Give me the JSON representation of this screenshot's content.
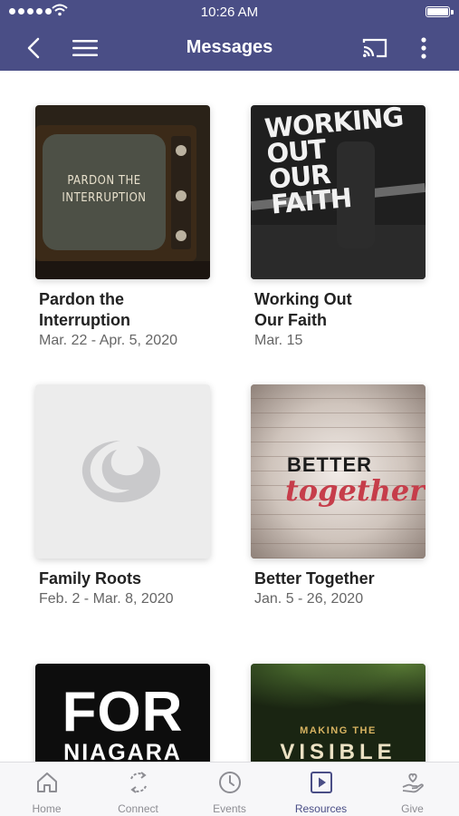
{
  "status_bar": {
    "time": "10:26 AM"
  },
  "header": {
    "title": "Messages"
  },
  "colors": {
    "accent": "#4a4e86",
    "tab_inactive": "#8d8d93"
  },
  "messages": [
    {
      "title": "Pardon the\nInterruption",
      "date": "Mar. 22 - Apr. 5, 2020",
      "art_text": "PARDON THE\nINTERRUPTION"
    },
    {
      "title": "Working Out\nOur Faith",
      "date": "Mar. 15",
      "art_text": "WORKING OUT\nOUR\nFAITH"
    },
    {
      "title": "Family Roots",
      "date": "Feb. 2 - Mar. 8, 2020"
    },
    {
      "title": "Better Together",
      "date": "Jan. 5 - 26, 2020",
      "art_text_1": "BETTER",
      "art_text_2": "together"
    },
    {
      "title": "",
      "date": "",
      "art_text_1": "FOR",
      "art_text_2": "NIAGARA"
    },
    {
      "title": "",
      "date": "",
      "art_text_1": "MAKING THE",
      "art_text_2": "VISIBLE"
    }
  ],
  "tabs": [
    {
      "label": "Home",
      "icon": "home-icon"
    },
    {
      "label": "Connect",
      "icon": "connect-icon"
    },
    {
      "label": "Events",
      "icon": "clock-icon"
    },
    {
      "label": "Resources",
      "icon": "play-square-icon",
      "active": true
    },
    {
      "label": "Give",
      "icon": "give-hand-icon"
    }
  ]
}
